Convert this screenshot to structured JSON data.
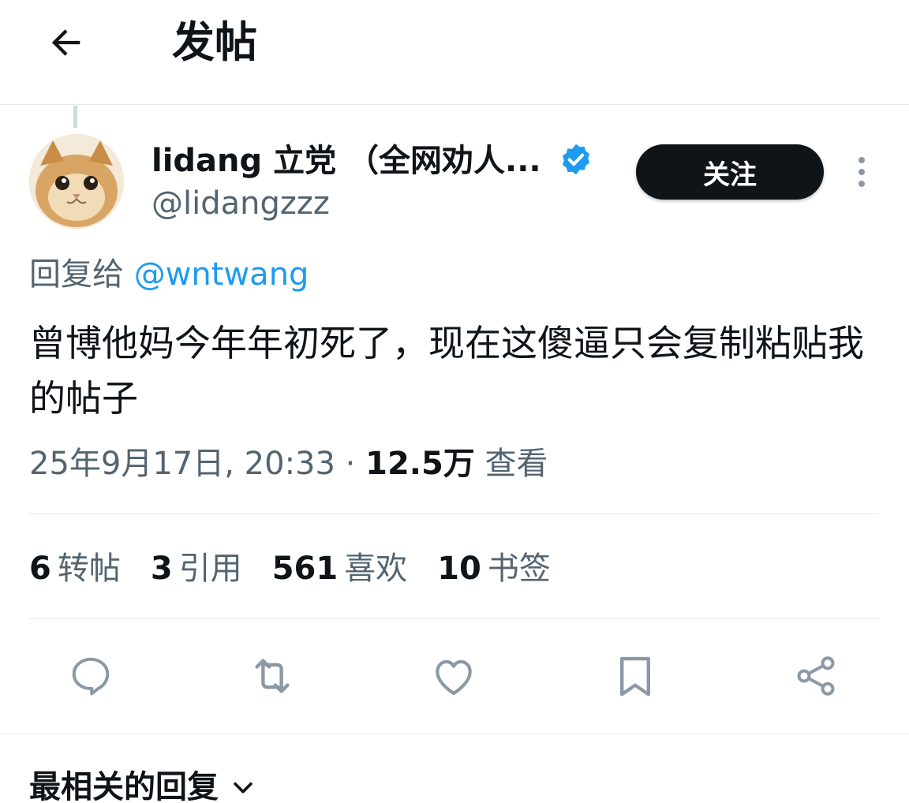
{
  "header": {
    "title": "发帖",
    "back_icon": "arrow-left-icon"
  },
  "post": {
    "author": {
      "display_name": "lidang 立党 （全网劝人...",
      "handle": "@lidangzzz",
      "verified": true,
      "verified_icon": "verified-badge-icon",
      "avatar": "cat-avatar"
    },
    "follow_label": "关注",
    "more_icon": "more-vertical-icon",
    "reply_prefix": "回复给",
    "reply_to": "@wntwang",
    "text": "曾博他妈今年年初死了，现在这傻逼只会复制粘贴我的帖子",
    "timestamp": "25年9月17日, 20:33",
    "separator": "·",
    "views_count": "12.5万",
    "views_label": "查看"
  },
  "stats": [
    {
      "num": "6",
      "label": "转帖"
    },
    {
      "num": "3",
      "label": "引用"
    },
    {
      "num": "561",
      "label": "喜欢"
    },
    {
      "num": "10",
      "label": "书签"
    }
  ],
  "actions": [
    "reply-icon",
    "repost-icon",
    "like-icon",
    "bookmark-icon",
    "share-icon"
  ],
  "replies_sort": {
    "label": "最相关的回复",
    "icon": "chevron-down-icon"
  },
  "colors": {
    "accent": "#1d9bf0",
    "text": "#0f1419",
    "secondary": "#536471",
    "border": "#e6e9ec"
  }
}
